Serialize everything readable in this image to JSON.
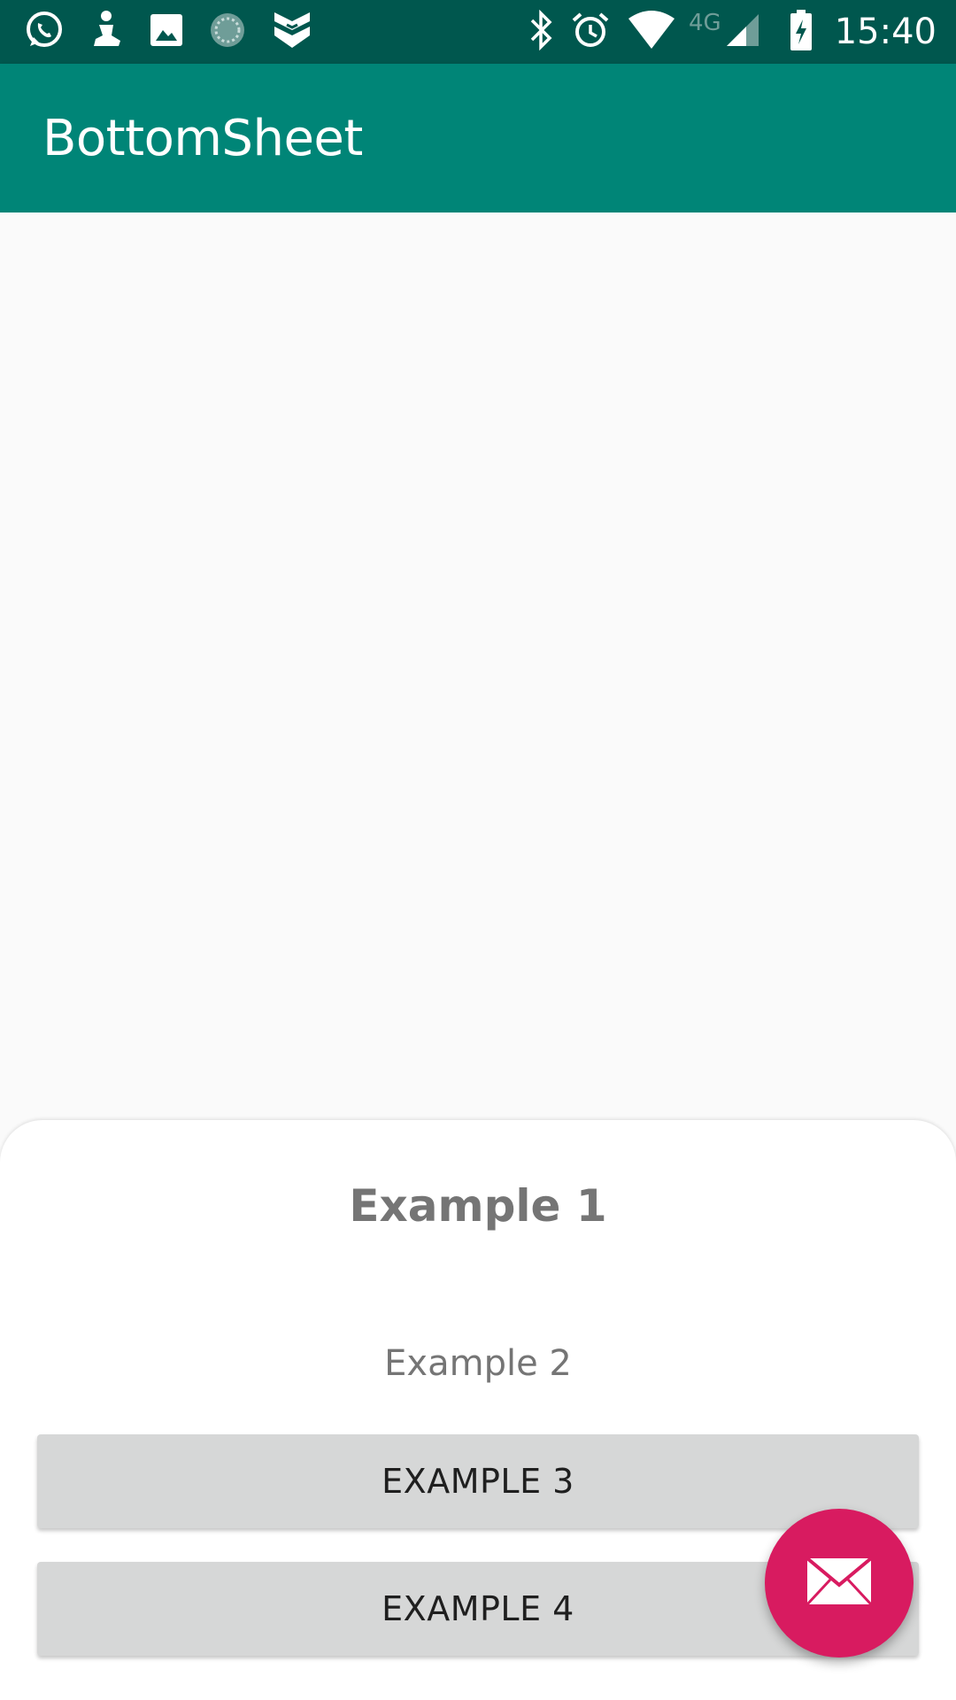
{
  "status_bar": {
    "time": "15:40",
    "network": "4G",
    "left_icons": [
      "whatsapp-icon",
      "figure-icon",
      "image-icon",
      "sync-icon",
      "badge-icon"
    ],
    "right_icons": [
      "bluetooth-icon",
      "alarm-icon",
      "wifi-icon",
      "signal-icon",
      "battery-charging-icon"
    ],
    "color": "#00574e"
  },
  "app_bar": {
    "title": "BottomSheet",
    "color": "#008577"
  },
  "bottom_sheet": {
    "title": "Example 1",
    "subtitle": "Example 2",
    "buttons": [
      {
        "label": "EXAMPLE 3"
      },
      {
        "label": "EXAMPLE 4"
      }
    ]
  },
  "fab": {
    "icon": "mail-icon",
    "color": "#d81b60"
  }
}
